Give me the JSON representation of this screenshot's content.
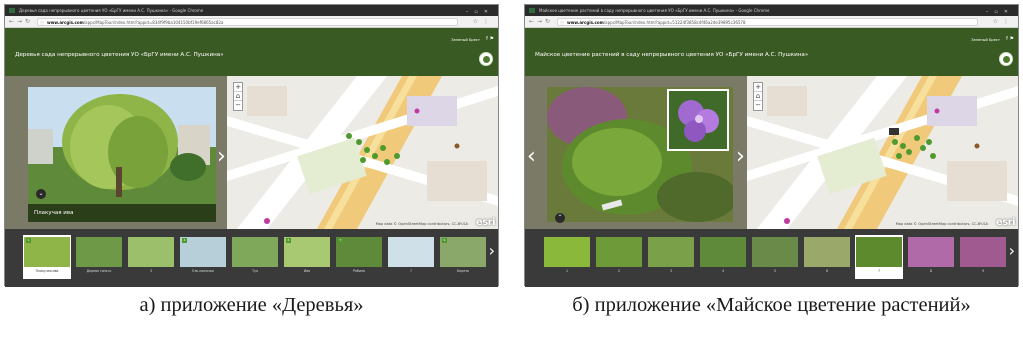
{
  "panels": [
    {
      "window_title": "Деревья сада непрерывного цветения УО «БрГУ имени А.С. Пушкина» - Google Chrome",
      "url_host": "www.arcgis.com",
      "url_path": "/apps/MapTour/index.html?appid=834f9f9ba104150bf19ef6865ac82a",
      "header_link": "Зеленый Брест",
      "app_title": "Деревья сада непрерывного цветения УО «БрГУ имени А.С. Пушкина»",
      "photo_caption": "Плакучая ива",
      "attribution": "Map data © OpenStreetMap contributors, CC-BY-SA",
      "esri": "esri",
      "thumbnails": [
        {
          "label": "Плакучая ива",
          "num": "1"
        },
        {
          "label": "Дерево гинкго",
          "num": ""
        },
        {
          "label": "3",
          "num": ""
        },
        {
          "label": "Ель колючая",
          "num": "4"
        },
        {
          "label": "Туя",
          "num": ""
        },
        {
          "label": "Ива",
          "num": "6"
        },
        {
          "label": "Рябина",
          "num": "7"
        },
        {
          "label": "7",
          "num": ""
        },
        {
          "label": "Береза",
          "num": "9"
        }
      ]
    },
    {
      "window_title": "Майское цветение растений в саду непрерывного цветения УО «БрГУ имени А.С. Пушкина» - Google Chrome",
      "url_host": "www.arcgis.com",
      "url_path": "/apps/MapTour/index.html?appid=51224f3858c4f46a2de39895c36578",
      "header_link": "Зеленый Брест",
      "app_title": "Майское цветение растений в саду непрерывного цветения УО «БрГУ имени А.С. Пушкина»",
      "attribution": "Map data © OpenStreetMap contributors, CC-BY-SA",
      "esri": "esri",
      "thumbnails": [
        {
          "label": "1",
          "num": ""
        },
        {
          "label": "2",
          "num": ""
        },
        {
          "label": "3",
          "num": ""
        },
        {
          "label": "4",
          "num": ""
        },
        {
          "label": "5",
          "num": ""
        },
        {
          "label": "6",
          "num": ""
        },
        {
          "label": "7",
          "num": ""
        },
        {
          "label": "8",
          "num": ""
        },
        {
          "label": "9",
          "num": ""
        }
      ]
    }
  ],
  "captions": {
    "a": "а) приложение «Деревья»",
    "b": "б) приложение «Майское цветение растений»"
  },
  "colors": {
    "header_green": "#3a5a24",
    "marker_green": "#4e9a2e",
    "street_orange": "#f0c97a"
  }
}
